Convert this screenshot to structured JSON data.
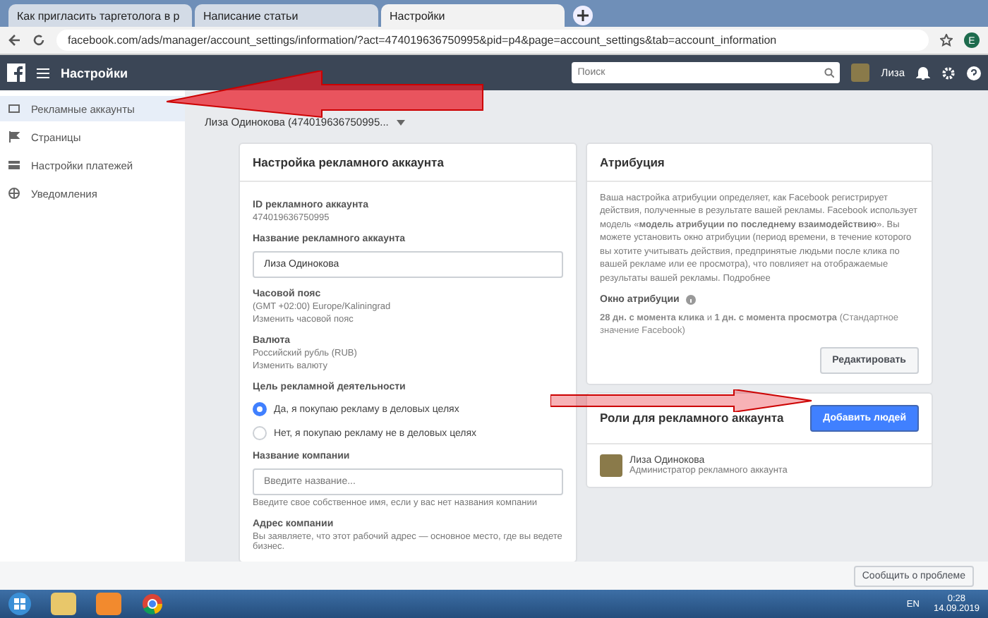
{
  "browser": {
    "tabs": [
      {
        "title": "Как пригласить таргетолога в р",
        "selected": false
      },
      {
        "title": "Написание статьи",
        "selected": false
      },
      {
        "title": "Настройки",
        "selected": true
      }
    ],
    "url": "facebook.com/ads/manager/account_settings/information/?act=474019636750995&pid=p4&page=account_settings&tab=account_information",
    "profile_initial": "E"
  },
  "header": {
    "title": "Настройки",
    "search": {
      "placeholder": "Поиск"
    },
    "user": "Лиза"
  },
  "sidebar": {
    "items": [
      {
        "label": "Рекламные аккаунты",
        "selected": true
      },
      {
        "label": "Страницы",
        "selected": false
      },
      {
        "label": "Настройки платежей",
        "selected": false
      },
      {
        "label": "Уведомления",
        "selected": false
      }
    ]
  },
  "account_selector": "Лиза Одинокова (474019636750995...",
  "settings_card": {
    "title": "Настройка рекламного аккаунта",
    "id_label": "ID рекламного аккаунта",
    "id_value": "474019636750995",
    "name_label": "Название рекламного аккаунта",
    "name_value": "Лиза Одинокова",
    "timezone_label": "Часовой пояс",
    "timezone_value": "(GMT +02:00) Europe/Kaliningrad",
    "timezone_link": "Изменить часовой пояс",
    "currency_label": "Валюта",
    "currency_value": "Российский рубль (RUB)",
    "currency_link": "Изменить валюту",
    "purpose_label": "Цель рекламной деятельности",
    "purpose_options": [
      {
        "label": "Да, я покупаю рекламу в деловых целях",
        "selected": true
      },
      {
        "label": "Нет, я покупаю рекламу не в деловых целях",
        "selected": false
      }
    ],
    "company_label": "Название компании",
    "company_placeholder": "Введите название...",
    "company_hint": "Введите свое собственное имя, если у вас нет названия компании",
    "address_label": "Адрес компании",
    "address_text": "Вы заявляете, что этот рабочий адрес — основное место, где вы ведете бизнес."
  },
  "attribution_card": {
    "title": "Атрибуция",
    "text": "Ваша настройка атрибуции определяет, как Facebook регистрирует действия, полученные в результате вашей рекламы. Facebook использует модель «**модель атрибуции по последнему взаимодействию**». Вы можете установить окно атрибуции (период времени, в течение которого вы хотите учитывать действия, предпринятые людьми после клика по вашей рекламе или ее просмотра), что повлияет на отображаемые результаты вашей рекламы.",
    "more_link": "Подробнее",
    "window_label": "Окно атрибуции",
    "window_value": "**28 дн. с момента клика** и **1 дн. с момента просмотра** (Стандартное значение Facebook)",
    "edit_button": "Редактировать"
  },
  "roles_card": {
    "title": "Роли для рекламного аккаунта",
    "add_button": "Добавить людей",
    "people": [
      {
        "name": "Лиза Одинокова",
        "role": "Администратор рекламного аккаунта"
      }
    ]
  },
  "report_button": "Сообщить о проблеме",
  "taskbar": {
    "language": "EN",
    "time": "0:28",
    "date": "14.09.2019"
  }
}
